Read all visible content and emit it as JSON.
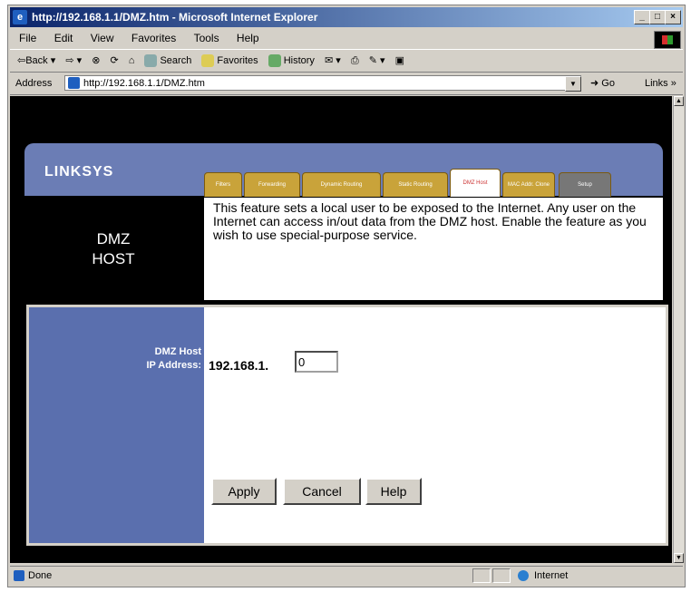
{
  "window": {
    "title": "http://192.168.1.1/DMZ.htm - Microsoft Internet Explorer"
  },
  "menu": [
    "File",
    "Edit",
    "View",
    "Favorites",
    "Tools",
    "Help"
  ],
  "toolbar": {
    "back": "Back",
    "search": "Search",
    "favorites": "Favorites",
    "history": "History"
  },
  "address": {
    "label": "Address",
    "url": "http://192.168.1.1/DMZ.htm",
    "go": "Go",
    "links": "Links"
  },
  "logo": "LINKSYS",
  "tabs": [
    {
      "label": "Filters"
    },
    {
      "label": "Forwarding"
    },
    {
      "label": "Dynamic Routing"
    },
    {
      "label": "Static Routing"
    },
    {
      "label": "DMZ Host"
    },
    {
      "label": "MAC Addr. Clone"
    },
    {
      "label": "Setup"
    }
  ],
  "section": {
    "title_line1": "DMZ",
    "title_line2": "HOST"
  },
  "description": "This feature sets a local user to be exposed to the Internet. Any user on the Internet can access in/out data from the DMZ host. Enable the feature as you wish to use special-purpose service.",
  "form": {
    "label_line1": "DMZ Host",
    "label_line2": "IP Address:",
    "ip_prefix": "192.168.1.",
    "ip_last_octet": "0"
  },
  "buttons": {
    "apply": "Apply",
    "cancel": "Cancel",
    "help": "Help"
  },
  "status": {
    "text": "Done",
    "zone": "Internet"
  }
}
